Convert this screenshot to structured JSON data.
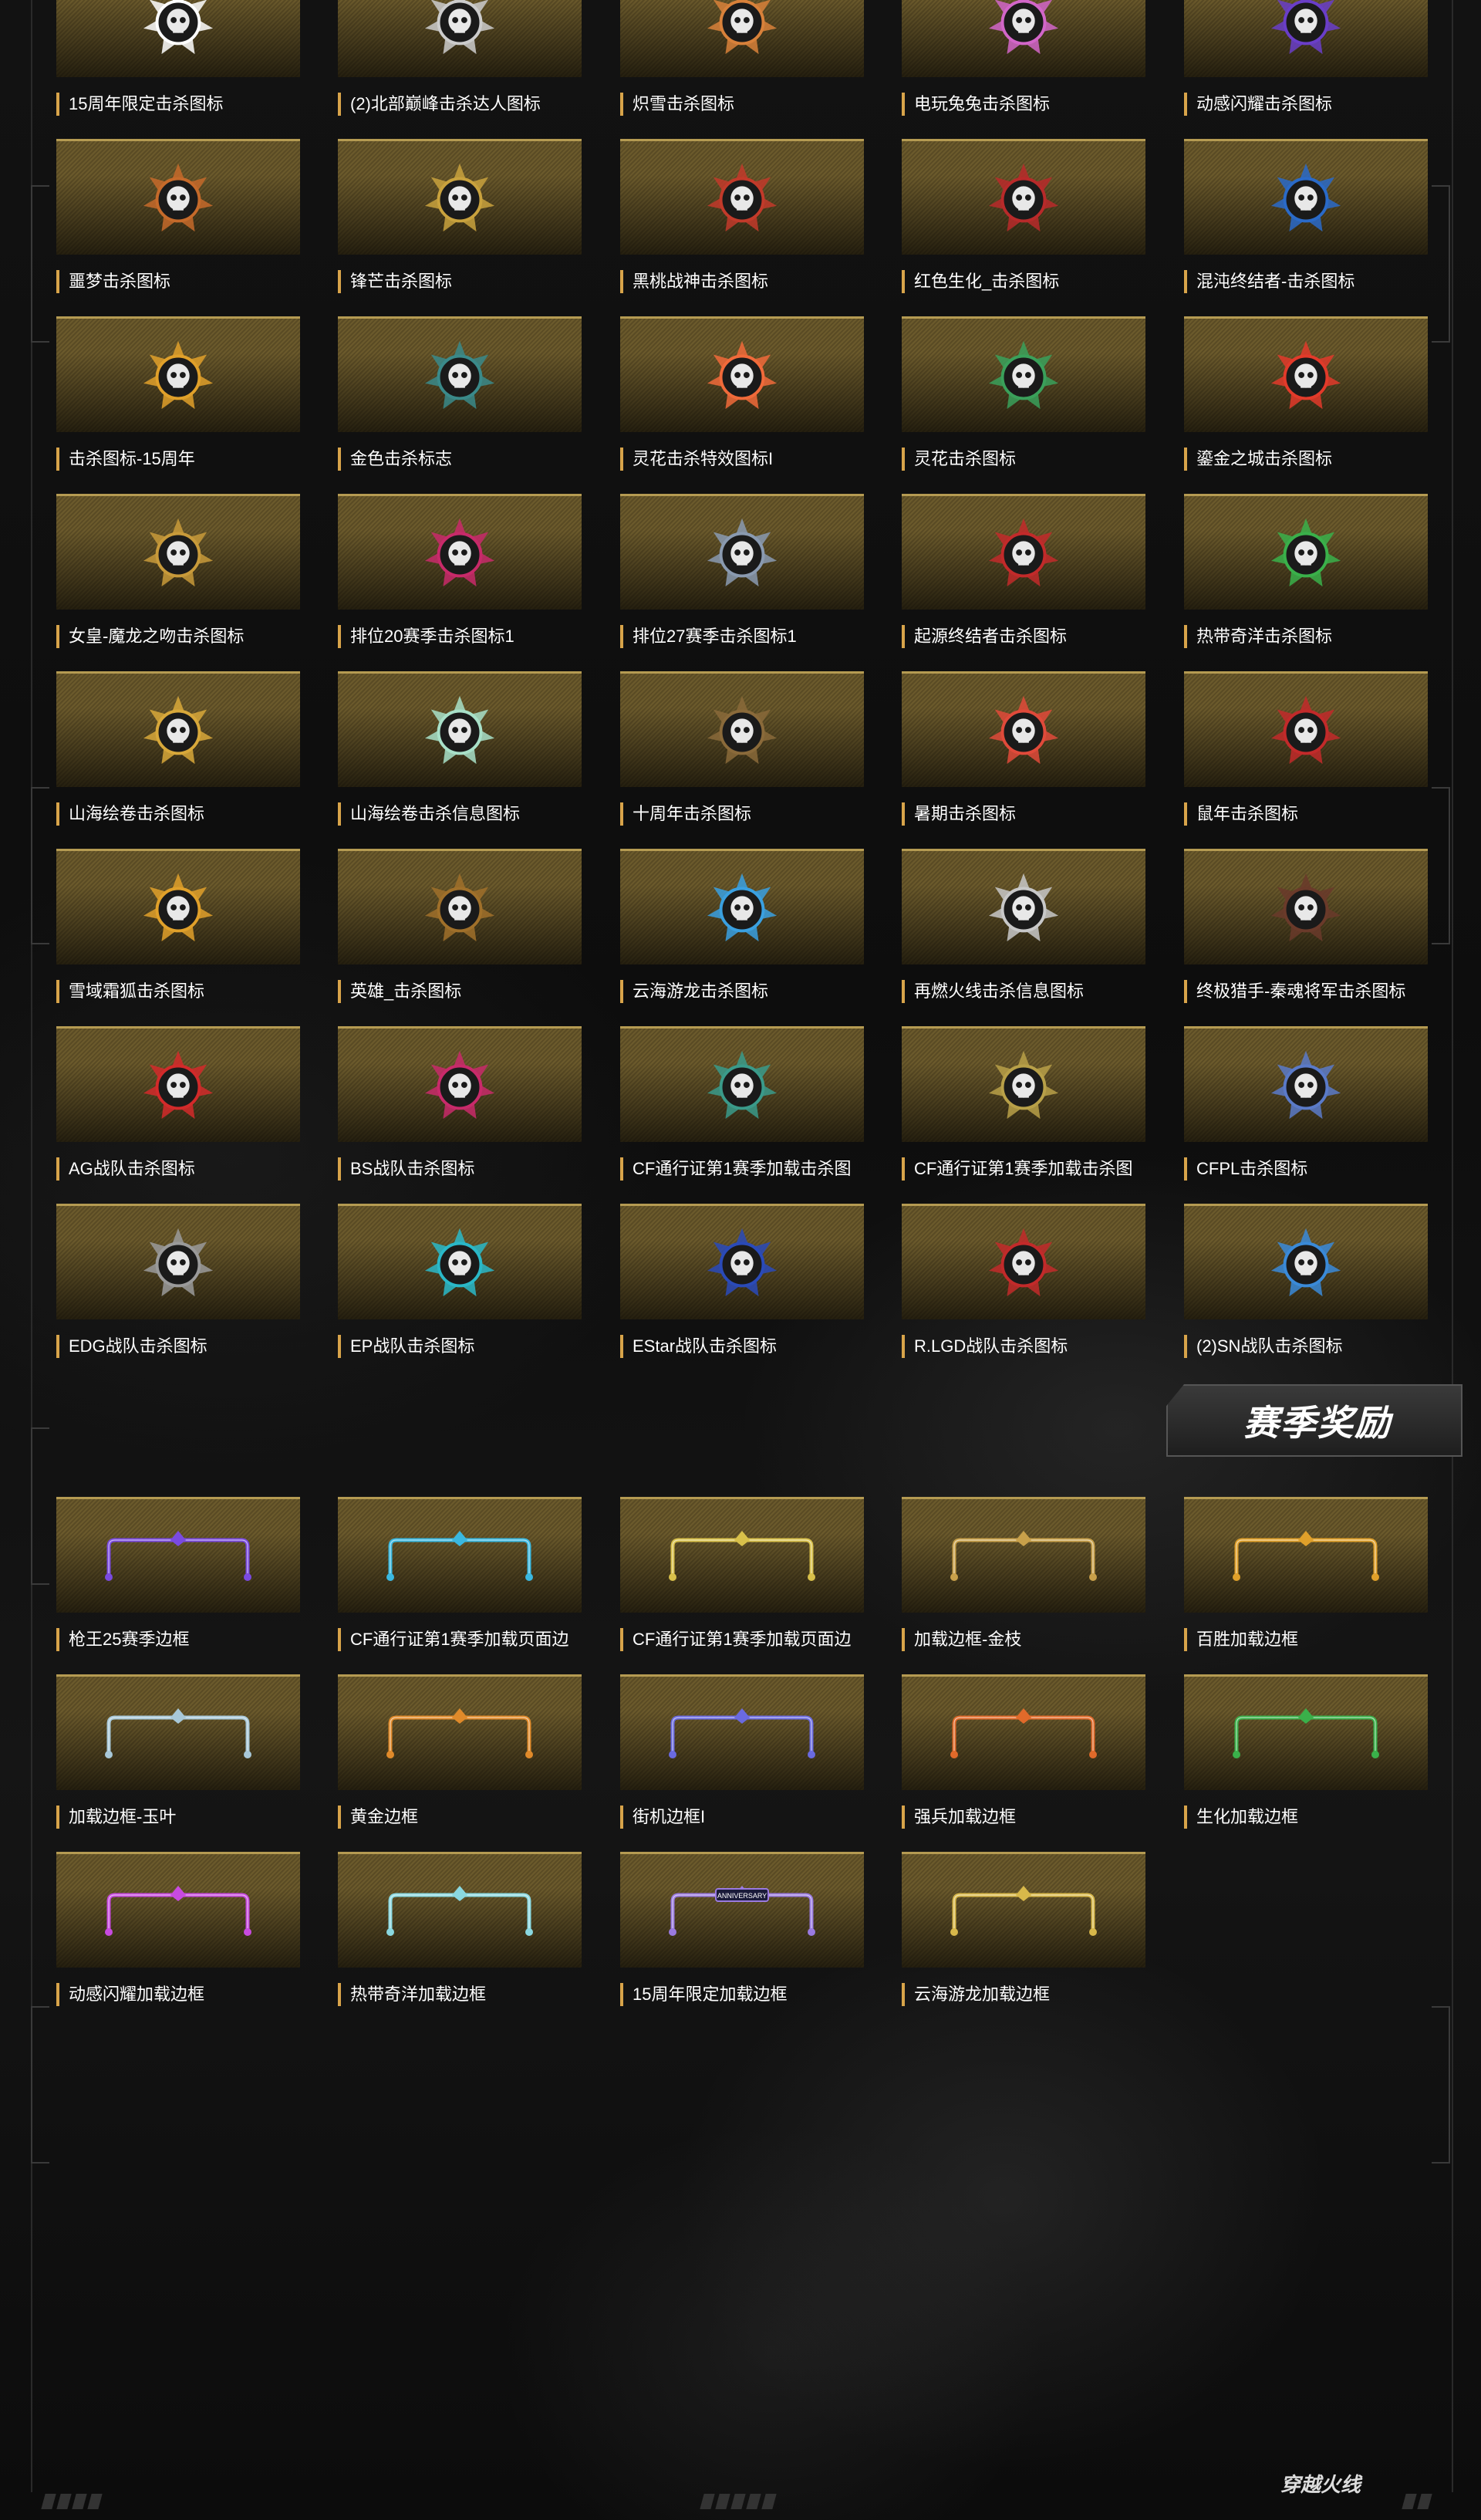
{
  "kill_icons": [
    {
      "label": "15周年限定击杀图标",
      "icon": "panda-skull-emblem",
      "color": "#ffffff"
    },
    {
      "label": "(2)北部巅峰击杀达人图标",
      "icon": "north-glyph-emblem",
      "color": "#cccccc"
    },
    {
      "label": "炽雪击杀图标",
      "icon": "wolf-emblem",
      "color": "#d8813a"
    },
    {
      "label": "电玩兔兔击杀图标",
      "icon": "rabbit-emblem",
      "color": "#d266c8"
    },
    {
      "label": "动感闪耀击杀图标",
      "icon": "star-emblem",
      "color": "#6a3ec8"
    },
    {
      "label": "噩梦击杀图标",
      "icon": "nightmare-emblem",
      "color": "#c56a2a"
    },
    {
      "label": "锋芒击杀图标",
      "icon": "winged-skull-emblem",
      "color": "#c9a23d"
    },
    {
      "label": "黑桃战神击杀图标",
      "icon": "spade-warrior-emblem",
      "color": "#c23a2a"
    },
    {
      "label": "红色生化_击杀图标",
      "icon": "red-bio-emblem",
      "color": "#b82a2a"
    },
    {
      "label": "混沌终结者-击杀图标",
      "icon": "chaos-terminator-emblem",
      "color": "#2a6ac8"
    },
    {
      "label": "击杀图标-15周年",
      "icon": "phoenix-emblem",
      "color": "#e0a02a"
    },
    {
      "label": "金色击杀标志",
      "icon": "gold-skull-emblem",
      "color": "#3a8a8a"
    },
    {
      "label": "灵花击杀特效图标I",
      "icon": "flower-emblem",
      "color": "#f06a3a"
    },
    {
      "label": "灵花击杀图标",
      "icon": "flower-girl-emblem",
      "color": "#3aa05a"
    },
    {
      "label": "鎏金之城击杀图标",
      "icon": "cf-logo-emblem",
      "color": "#e23a2a"
    },
    {
      "label": "女皇-魔龙之吻击杀图标",
      "icon": "dragon-queen-emblem",
      "color": "#c89a3a"
    },
    {
      "label": "排位20赛季击杀图标1",
      "icon": "ranked-s20-emblem",
      "color": "#c82a6a"
    },
    {
      "label": "排位27赛季击杀图标1",
      "icon": "ranked-s27-emblem",
      "color": "#8a9ab0"
    },
    {
      "label": "起源终结者击杀图标",
      "icon": "origin-terminator-emblem",
      "color": "#c22a2a"
    },
    {
      "label": "热带奇洋击杀图标",
      "icon": "tropical-emblem",
      "color": "#3ab04a"
    },
    {
      "label": "山海绘卷击杀图标",
      "icon": "shanhai-emblem",
      "color": "#d8a83a"
    },
    {
      "label": "山海绘卷击杀信息图标",
      "icon": "jade-flower-emblem",
      "color": "#a8e0c8"
    },
    {
      "label": "十周年击杀图标",
      "icon": "tenth-anniversary-emblem",
      "color": "#8a6a3a"
    },
    {
      "label": "暑期击杀图标",
      "icon": "watermelon-emblem",
      "color": "#e04a3a"
    },
    {
      "label": "鼠年击杀图标",
      "icon": "rat-year-emblem",
      "color": "#c22a2a"
    },
    {
      "label": "雪域霜狐击杀图标",
      "icon": "snow-fox-emblem",
      "color": "#e0a02a"
    },
    {
      "label": "英雄_击杀图标",
      "icon": "hero-emblem",
      "color": "#a0702a"
    },
    {
      "label": "云海游龙击杀图标",
      "icon": "cloud-dragon-emblem",
      "color": "#3aa0e0"
    },
    {
      "label": "再燃火线击杀信息图标",
      "icon": "dog-tag-emblem",
      "color": "#c8c8c8"
    },
    {
      "label": "终极猎手-秦魂将军击杀图标",
      "icon": "general-emblem",
      "color": "#6a3a2a"
    },
    {
      "label": "AG战队击杀图标",
      "icon": "ag-team-emblem",
      "color": "#d22a2a"
    },
    {
      "label": "BS战队击杀图标",
      "icon": "bs-team-emblem",
      "color": "#c82a6a"
    },
    {
      "label": "CF通行证第1赛季加载击杀图",
      "icon": "cf-pass-emblem",
      "color": "#3a9a8a"
    },
    {
      "label": "CF通行证第1赛季加载击杀图",
      "icon": "cf-pass-emblem-2",
      "color": "#b8a048"
    },
    {
      "label": "CFPL击杀图标",
      "icon": "cfpl-emblem",
      "color": "#5a7ac8"
    },
    {
      "label": "EDG战队击杀图标",
      "icon": "edg-team-emblem",
      "color": "#9a9a9a"
    },
    {
      "label": "EP战队击杀图标",
      "icon": "ep-team-emblem",
      "color": "#2ab8c8"
    },
    {
      "label": "EStar战队击杀图标",
      "icon": "estar-team-emblem",
      "color": "#2a4ab8"
    },
    {
      "label": "R.LGD战队击杀图标",
      "icon": "rlgd-team-emblem",
      "color": "#c22a2a"
    },
    {
      "label": "(2)SN战队击杀图标",
      "icon": "sn-team-emblem",
      "color": "#3a8ad8"
    }
  ],
  "section_title": "赛季奖励",
  "frames": [
    {
      "label": "枪王25赛季边框",
      "icon": "frame-purple",
      "color": "#7a4ae0"
    },
    {
      "label": "CF通行证第1赛季加载页面边",
      "icon": "frame-cyan",
      "color": "#3ab8e0"
    },
    {
      "label": "CF通行证第1赛季加载页面边",
      "icon": "frame-gold-thin",
      "color": "#d8c04a"
    },
    {
      "label": "加载边框-金枝",
      "icon": "frame-gold-branch",
      "color": "#c8a04a"
    },
    {
      "label": "百胜加载边框",
      "icon": "frame-gold-wing",
      "color": "#e0a02a"
    },
    {
      "label": "加载边框-玉叶",
      "icon": "frame-jade",
      "color": "#a8c8d8"
    },
    {
      "label": "黄金边框",
      "icon": "frame-golden",
      "color": "#e08a2a"
    },
    {
      "label": "街机边框I",
      "icon": "frame-arcade",
      "color": "#6a6ae0"
    },
    {
      "label": "强兵加载边框",
      "icon": "frame-soldier",
      "color": "#e06a2a"
    },
    {
      "label": "生化加载边框",
      "icon": "frame-bio",
      "color": "#3ab04a"
    },
    {
      "label": "动感闪耀加载边框",
      "icon": "frame-shiny",
      "color": "#c84ae0"
    },
    {
      "label": "热带奇洋加载边框",
      "icon": "frame-tropical",
      "color": "#8ad8e0"
    },
    {
      "label": "15周年限定加载边框",
      "icon": "frame-anniversary",
      "color": "#9a7ae0",
      "badge": "ANNIVERSARY"
    },
    {
      "label": "云海游龙加载边框",
      "icon": "frame-cloud-dragon",
      "color": "#d8b84a"
    }
  ],
  "footer": {
    "logo_text": "穿越火线"
  }
}
